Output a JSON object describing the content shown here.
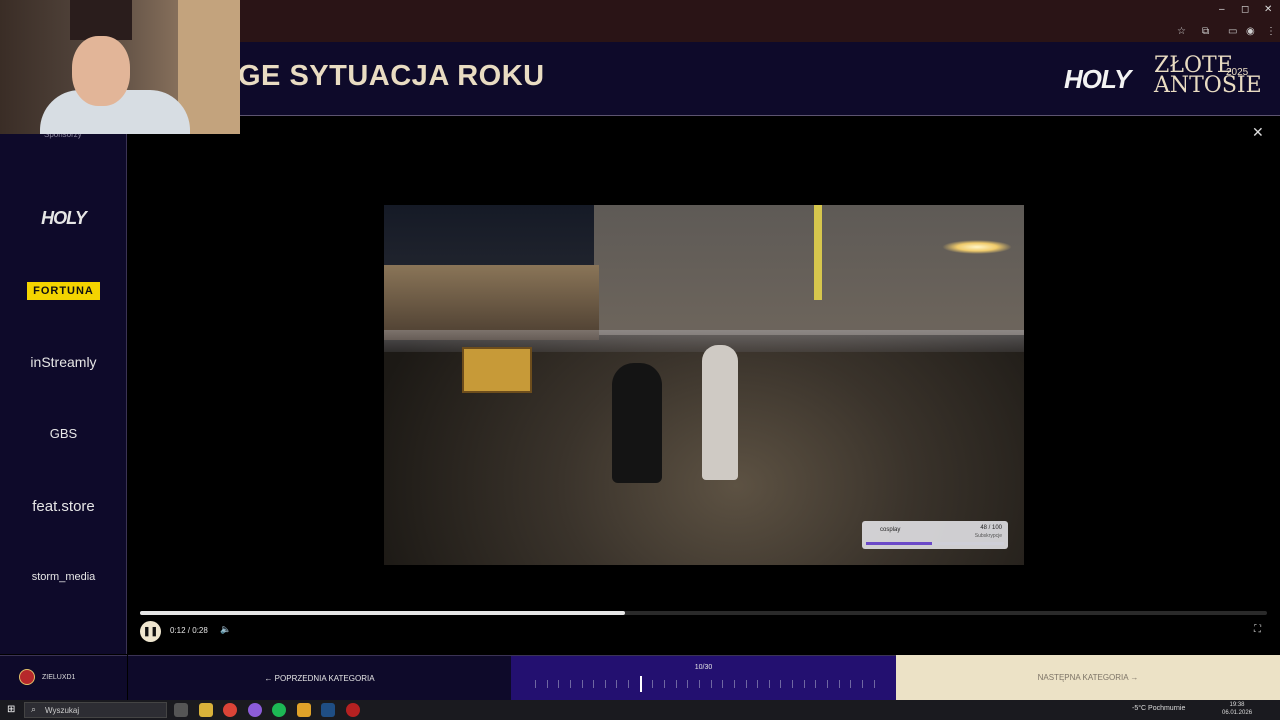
{
  "browser": {
    "window_controls": {
      "minimize": "–",
      "maximize": "◻",
      "close": "✕"
    },
    "toolbar_icons": [
      "star-icon",
      "extension-icon",
      "cast-icon",
      "profile-icon",
      "menu-icon"
    ]
  },
  "header": {
    "title": "GE SYTUACJA ROKU",
    "logo_holy": "HOLY",
    "logo_zlote": "ZŁOTE",
    "logo_antosie": "ANTOSIE",
    "logo_year": "2025"
  },
  "sidebar": {
    "label": "Sponsorzy",
    "sponsors": [
      "HOLY",
      "FORTUNA",
      "inStreamly",
      "GBS",
      "feat.store",
      "storm_media"
    ]
  },
  "player": {
    "close_label": "✕",
    "time": "0:12 / 0:28",
    "progress": 0.43,
    "overlay": {
      "name": "cosplay",
      "count": "48 / 100",
      "word": "Subskrypcje",
      "fill": 0.48
    },
    "pause_glyph": "❚❚",
    "volume_glyph": "🔈",
    "fullscreen_glyph": "⛶"
  },
  "bottom_nav": {
    "user": "ZIELUXD1",
    "prev_label": "← POPRZEDNIA KATEGORIA",
    "counter": "10/30",
    "total_ticks": 30,
    "active_tick": 10,
    "next_label": "NASTĘPNA KATEGORIA →"
  },
  "taskbar": {
    "search_placeholder": "Wyszukaj",
    "weather": "-5°C Pochmurnie",
    "time": "19:38",
    "date": "06.01.2026"
  },
  "colors": {
    "header_bg": "#0e0a2a",
    "accent_gold": "#e9dcc2",
    "purple": "#231070",
    "fortuna_yellow": "#f4d400"
  }
}
